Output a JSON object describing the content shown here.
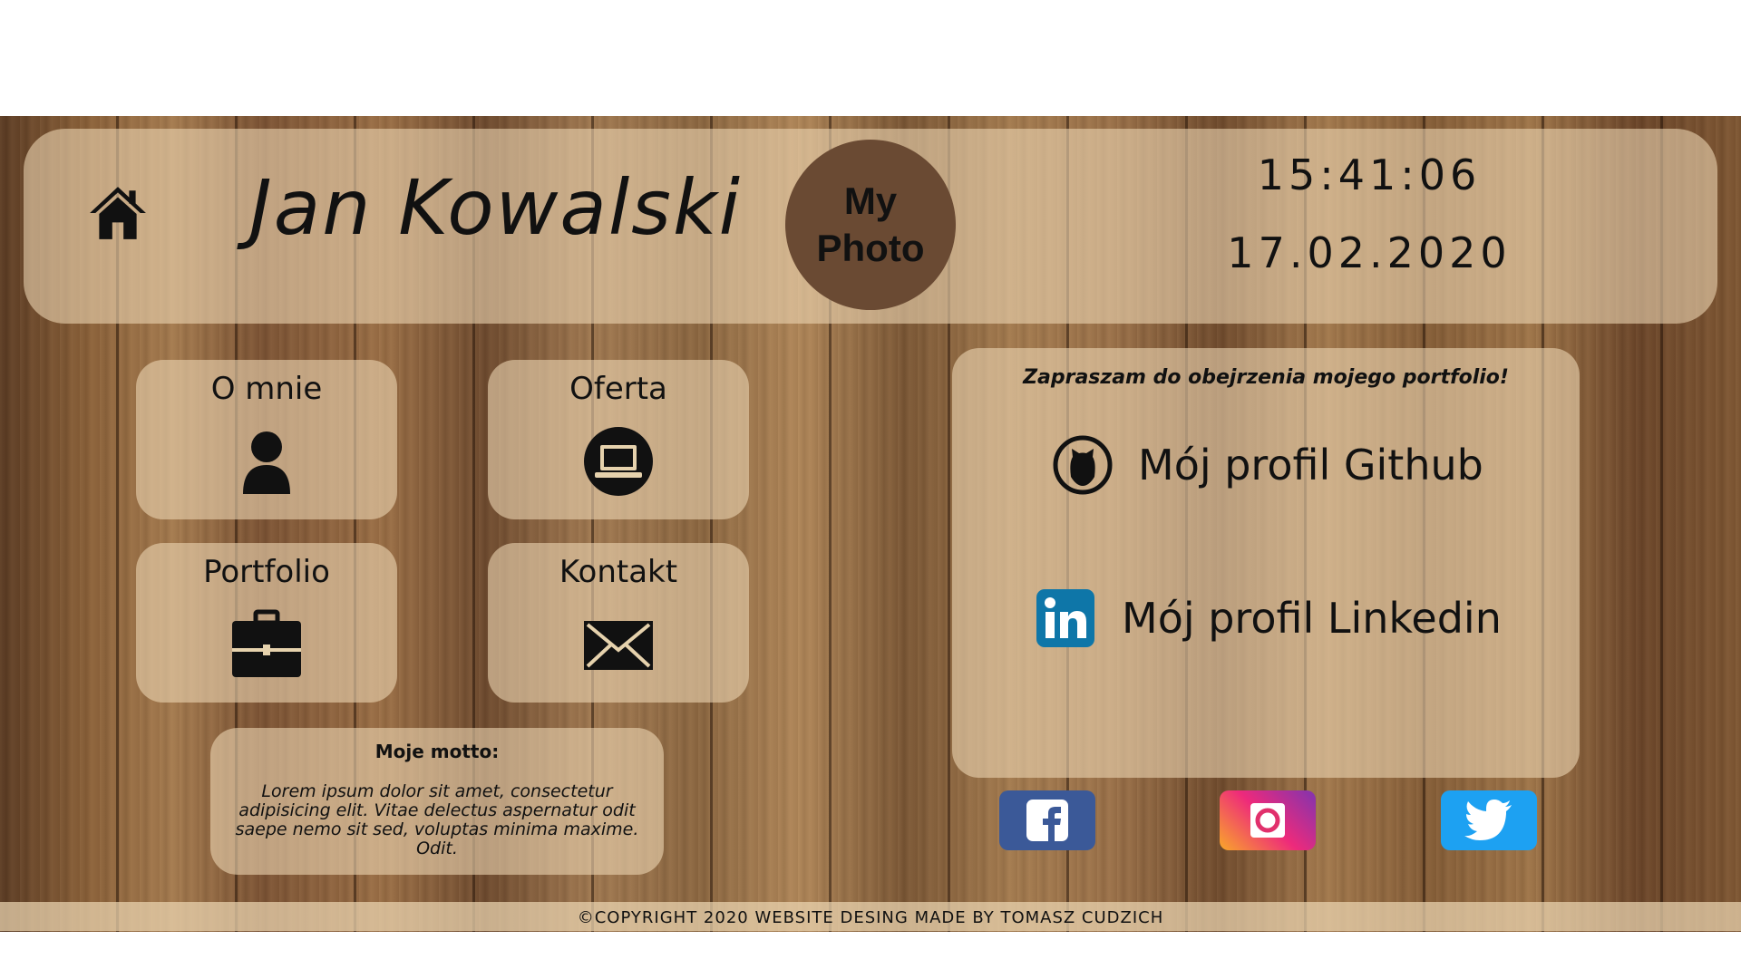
{
  "header": {
    "name": "Jan Kowalski",
    "photo_line1": "My",
    "photo_line2": "Photo",
    "time": "15:41:06",
    "date": "17.02.2020",
    "home_icon": "home-icon"
  },
  "nav": {
    "tiles": [
      {
        "label": "O mnie",
        "icon": "user-icon"
      },
      {
        "label": "Oferta",
        "icon": "laptop-icon"
      },
      {
        "label": "Portfolio",
        "icon": "briefcase-icon"
      },
      {
        "label": "Kontakt",
        "icon": "envelope-icon"
      }
    ]
  },
  "motto": {
    "title": "Moje motto:",
    "text": "Lorem ipsum dolor sit amet, consectetur adipisicing elit. Vitae delectus aspernatur odit saepe nemo sit sed, voluptas minima maxime. Odit."
  },
  "portfolio": {
    "invite": "Zapraszam do obejrzenia mojego portfolio!",
    "github_label": "Mój profil Github",
    "linkedin_label": "Mój profil Linkedin",
    "github_icon": "github-icon",
    "linkedin_icon": "linkedin-icon"
  },
  "social": {
    "items": [
      {
        "name": "facebook",
        "icon": "facebook-icon",
        "color": "#3b5998"
      },
      {
        "name": "instagram",
        "icon": "instagram-icon",
        "color": "#e1306c"
      },
      {
        "name": "twitter",
        "icon": "twitter-icon",
        "color": "#1da1f2"
      }
    ]
  },
  "footer": {
    "text": "©COPYRIGHT 2020 WEBSITE DESING MADE BY TOMASZ CUDZICH"
  },
  "colors": {
    "glass": "#ecd6b2",
    "photo_bg": "#6a4a33",
    "text": "#111111"
  }
}
